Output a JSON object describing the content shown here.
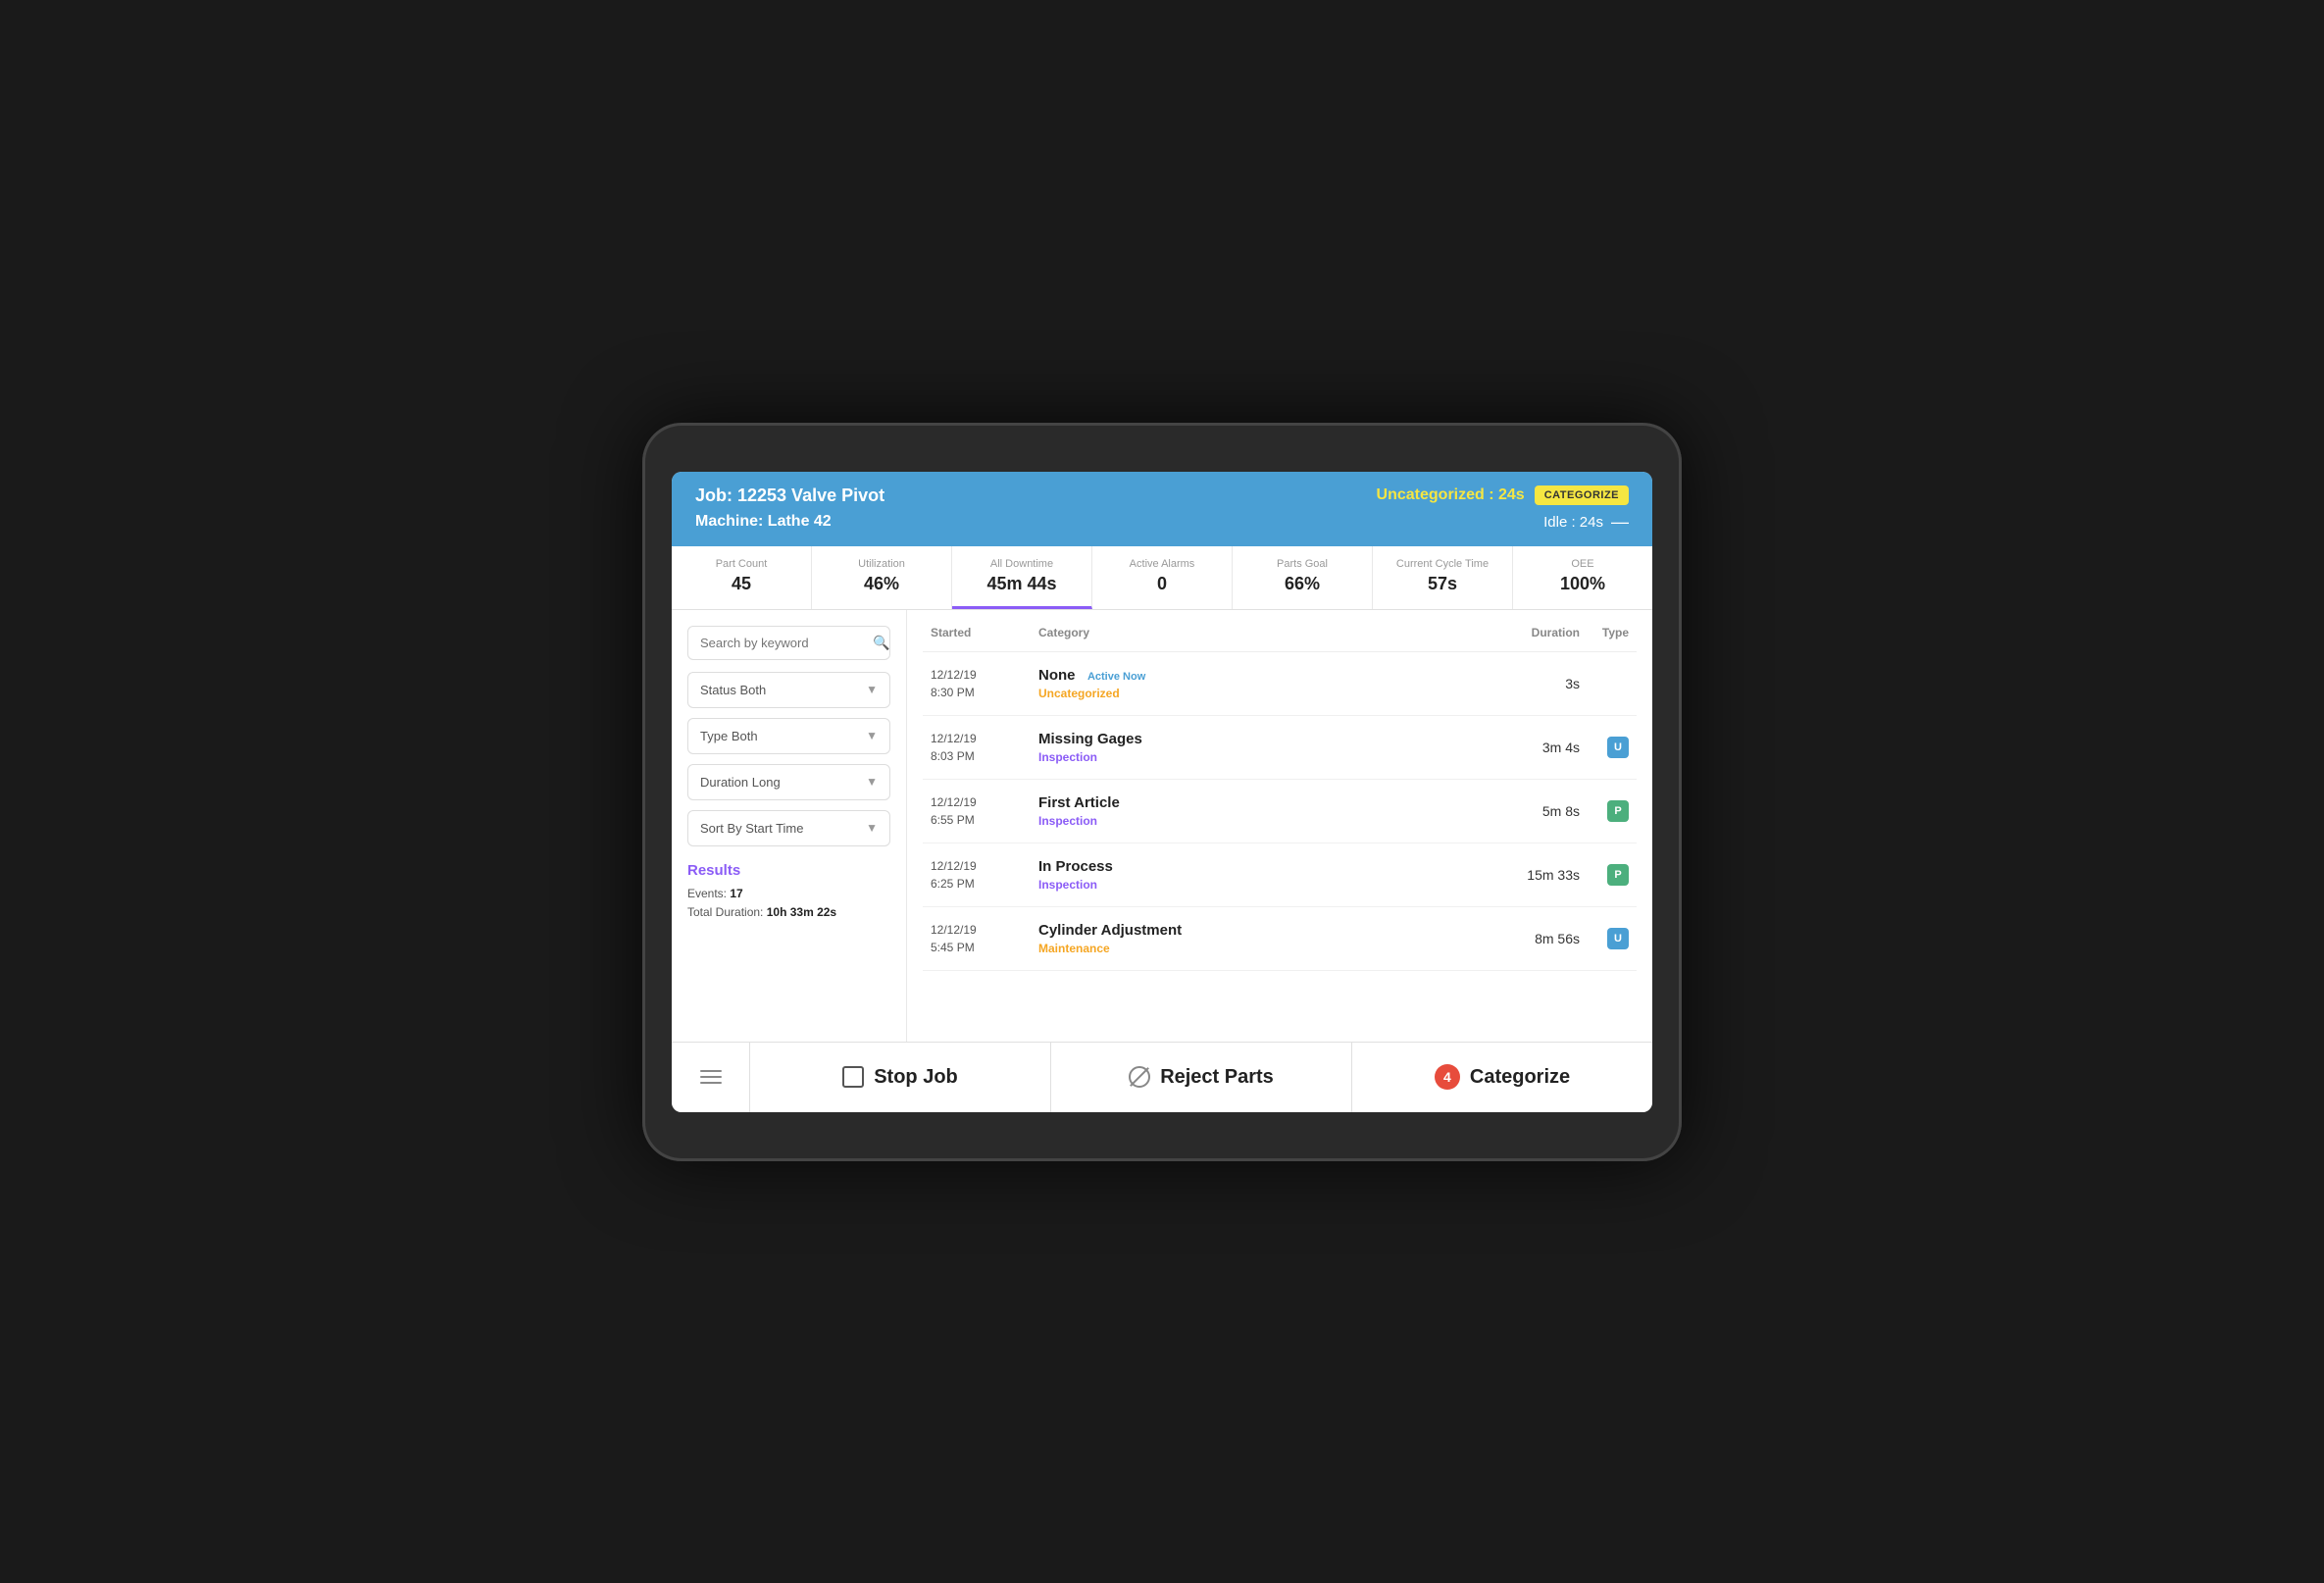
{
  "header": {
    "job_label": "Job: 12253 Valve Pivot",
    "machine_label": "Machine: Lathe 42",
    "uncategorized_label": "Uncategorized : 24s",
    "categorize_btn": "CATEGORIZE",
    "idle_label": "Idle : 24s"
  },
  "stats": [
    {
      "label": "Part Count",
      "value": "45",
      "active": false
    },
    {
      "label": "Utilization",
      "value": "46%",
      "active": false
    },
    {
      "label": "All Downtime",
      "value": "45m 44s",
      "active": true
    },
    {
      "label": "Active Alarms",
      "value": "0",
      "active": false
    },
    {
      "label": "Parts Goal",
      "value": "66%",
      "active": false
    },
    {
      "label": "Current Cycle Time",
      "value": "57s",
      "active": false
    },
    {
      "label": "OEE",
      "value": "100%",
      "active": false
    }
  ],
  "sidebar": {
    "search_placeholder": "Search by keyword",
    "filters": [
      {
        "label": "Status",
        "value": "Both"
      },
      {
        "label": "Type",
        "value": "Both"
      },
      {
        "label": "Duration",
        "value": "Long"
      },
      {
        "label": "Sort By",
        "value": "Start Time"
      }
    ],
    "results": {
      "title": "Results",
      "events_label": "Events:",
      "events_count": "17",
      "duration_label": "Total Duration:",
      "duration_value": "10h 33m 22s"
    }
  },
  "events": {
    "headers": {
      "started": "Started",
      "category": "Category",
      "duration": "Duration",
      "type": "Type"
    },
    "rows": [
      {
        "date": "12/12/19",
        "time": "8:30 PM",
        "name": "None",
        "active_badge": "Active Now",
        "sub": "Uncategorized",
        "sub_class": "sub-uncategorized",
        "duration": "3s",
        "type": "",
        "type_class": ""
      },
      {
        "date": "12/12/19",
        "time": "8:03 PM",
        "name": "Missing Gages",
        "active_badge": "",
        "sub": "Inspection",
        "sub_class": "sub-inspection",
        "duration": "3m 4s",
        "type": "U",
        "type_class": "type-u"
      },
      {
        "date": "12/12/19",
        "time": "6:55 PM",
        "name": "First Article",
        "active_badge": "",
        "sub": "Inspection",
        "sub_class": "sub-inspection",
        "duration": "5m 8s",
        "type": "P",
        "type_class": "type-p"
      },
      {
        "date": "12/12/19",
        "time": "6:25 PM",
        "name": "In Process",
        "active_badge": "",
        "sub": "Inspection",
        "sub_class": "sub-inspection",
        "duration": "15m 33s",
        "type": "P",
        "type_class": "type-p"
      },
      {
        "date": "12/12/19",
        "time": "5:45 PM",
        "name": "Cylinder Adjustment",
        "active_badge": "",
        "sub": "Maintenance",
        "sub_class": "sub-maintenance",
        "duration": "8m 56s",
        "type": "U",
        "type_class": "type-u"
      }
    ]
  },
  "bottom_bar": {
    "stop_job_label": "Stop Job",
    "reject_parts_label": "Reject Parts",
    "categorize_label": "Categorize",
    "categorize_count": "4"
  }
}
